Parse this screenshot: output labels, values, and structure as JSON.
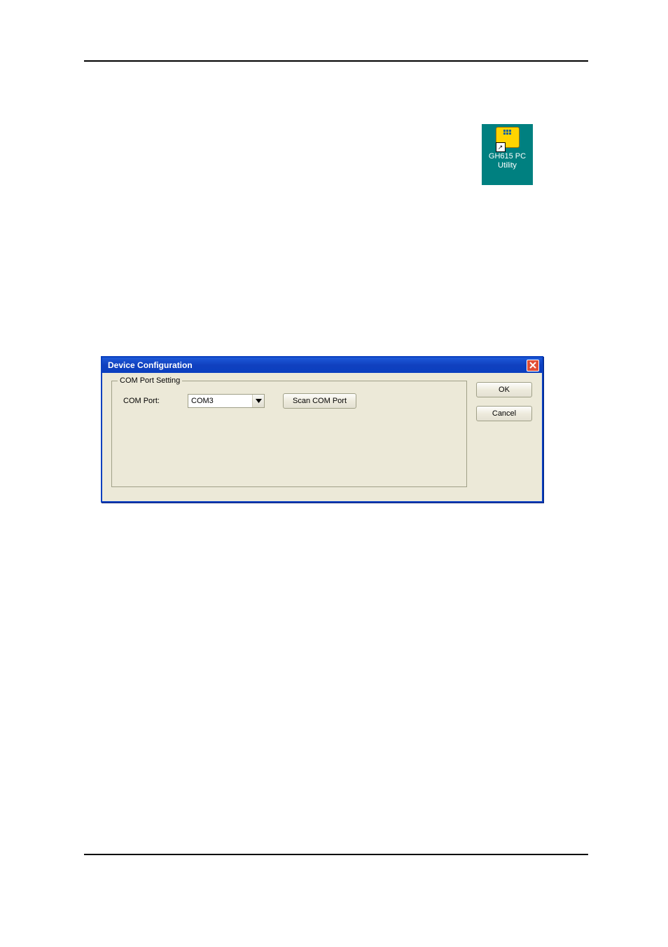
{
  "desktop_icon": {
    "line1": "GH615 PC",
    "line2": "Utility",
    "shortcut_glyph": "↗"
  },
  "dialog": {
    "title": "Device Configuration",
    "fieldset_legend": "COM Port Setting",
    "com_port_label": "COM Port:",
    "com_port_value": "COM3",
    "scan_button": "Scan COM Port",
    "ok_button": "OK",
    "cancel_button": "Cancel"
  }
}
